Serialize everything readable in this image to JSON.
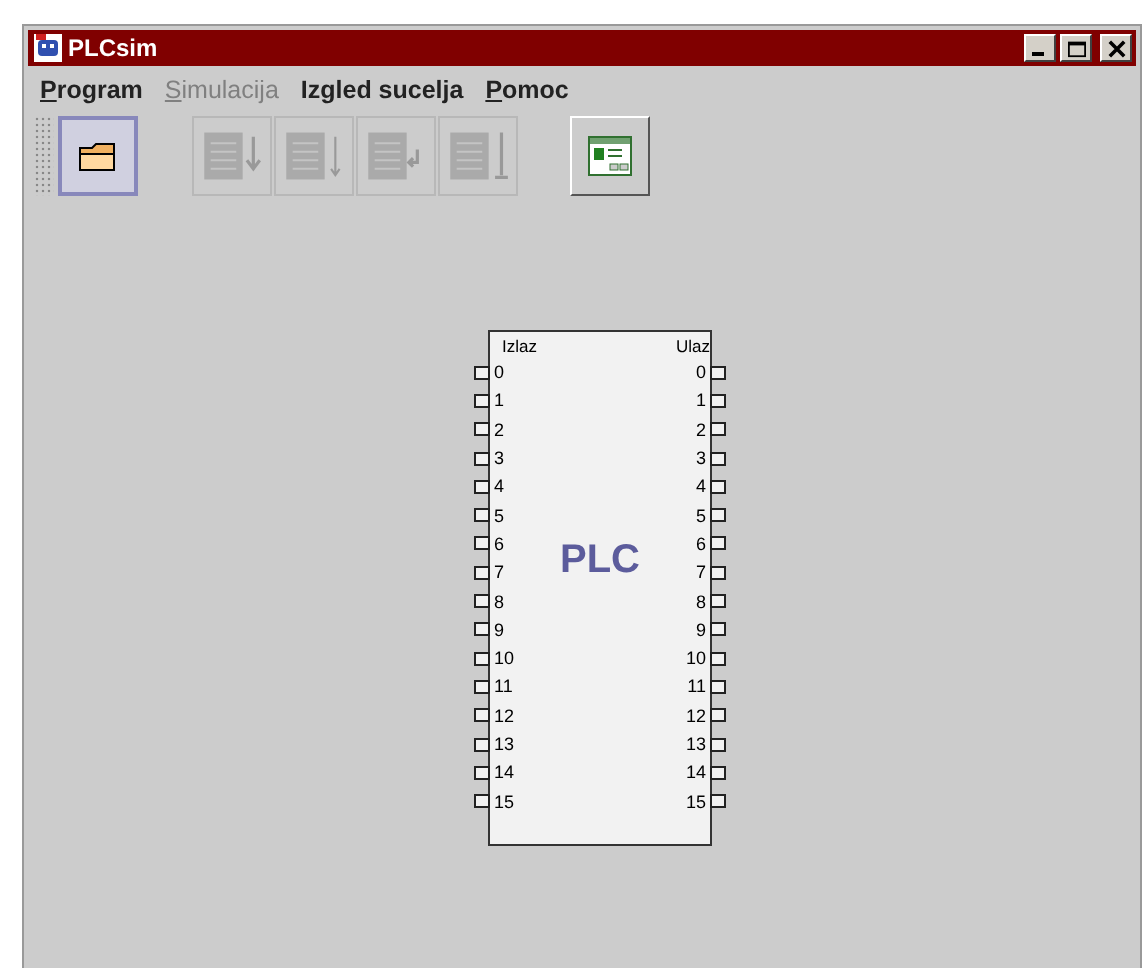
{
  "window": {
    "title": "PLCsim"
  },
  "menu": [
    {
      "label": "Program",
      "disabled": false,
      "underlined_first": true
    },
    {
      "label": "Simulacija",
      "disabled": true,
      "underlined_first": true
    },
    {
      "label": "Izgled sucelja",
      "disabled": false,
      "underlined_first": false
    },
    {
      "label": "Pomoc",
      "disabled": false,
      "underlined_first": true
    }
  ],
  "toolbar": [
    {
      "kind": "open",
      "disabled": false,
      "selected": true
    },
    {
      "kind": "step",
      "disabled": true,
      "selected": false
    },
    {
      "kind": "run",
      "disabled": true,
      "selected": false
    },
    {
      "kind": "loop",
      "disabled": true,
      "selected": false
    },
    {
      "kind": "stop",
      "disabled": true,
      "selected": false
    },
    {
      "kind": "panel",
      "disabled": false,
      "selected": false
    }
  ],
  "plc": {
    "title": "PLC",
    "output_label": "Izlaz",
    "input_label": "Ulaz",
    "outputs": [
      "0",
      "1",
      "2",
      "3",
      "4",
      "5",
      "6",
      "7",
      "8",
      "9",
      "10",
      "11",
      "12",
      "13",
      "14",
      "15"
    ],
    "inputs": [
      "0",
      "1",
      "2",
      "3",
      "4",
      "5",
      "6",
      "7",
      "8",
      "9",
      "10",
      "11",
      "12",
      "13",
      "14",
      "15"
    ]
  }
}
